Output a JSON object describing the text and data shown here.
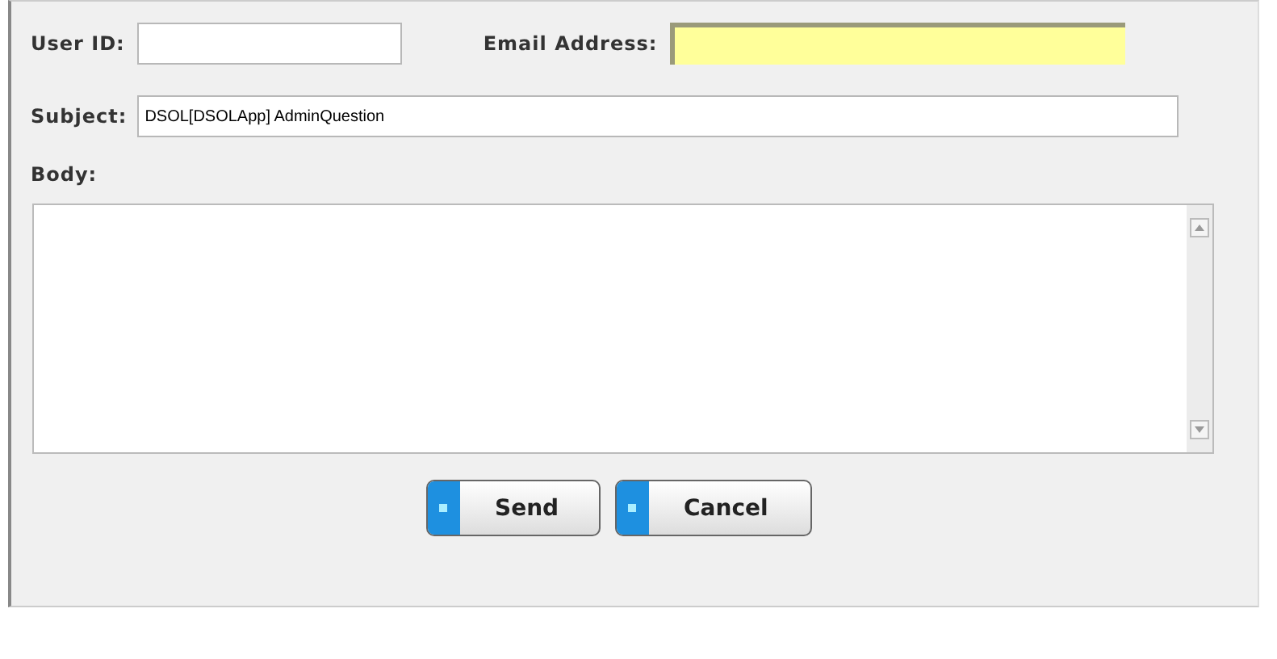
{
  "form": {
    "user_id": {
      "label": "User ID:"
    },
    "email": {
      "label": "Email Address:",
      "highlighted": true
    },
    "subject": {
      "label": "Subject:",
      "value": "DSOL[DSOLApp] AdminQuestion"
    },
    "body": {
      "label": "Body:"
    }
  },
  "buttons": [
    {
      "label": "Send"
    },
    {
      "label": "Cancel"
    }
  ]
}
